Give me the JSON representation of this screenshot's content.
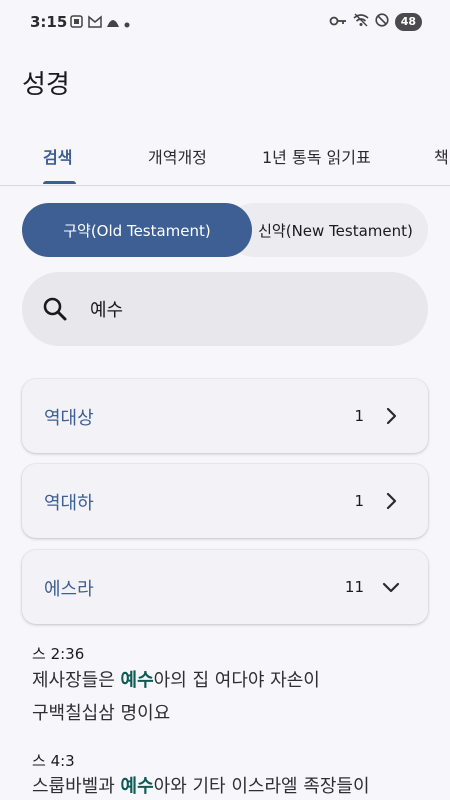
{
  "status_bar": {
    "time": "3:15",
    "battery": "48",
    "left_icons": [
      "screenshot-icon",
      "gmail-icon",
      "app-icon",
      "dot-icon"
    ],
    "right_icons": [
      "key-icon",
      "wifi-off-icon",
      "do-not-disturb-icon"
    ]
  },
  "app": {
    "title": "성경"
  },
  "tabs": [
    {
      "label": "검색"
    },
    {
      "label": "개역개정"
    },
    {
      "label": "1년 통독 읽기표"
    },
    {
      "label": "책"
    }
  ],
  "testament": {
    "old": "구약(Old Testament)",
    "new": "신약(New Testament)"
  },
  "search": {
    "value": "예수",
    "icon": "search-icon"
  },
  "books": [
    {
      "name": "역대상",
      "count": "1",
      "chevron": "chevron-right-icon"
    },
    {
      "name": "역대하",
      "count": "1",
      "chevron": "chevron-right-icon"
    },
    {
      "name": "에스라",
      "count": "11",
      "chevron": "chevron-down-icon"
    }
  ],
  "verses": [
    {
      "ref": "스 2:36",
      "line1_pre": "제사장들은 ",
      "line1_hl": "예수",
      "line1_post": "아의 집 여다야 자손이",
      "line2": "구백칠십삼 명이요"
    },
    {
      "ref": "스 4:3",
      "line1_pre": "스룹바벨과 ",
      "line1_hl": "예수",
      "line1_post": "아와 기타 이스라엘 족장들이"
    }
  ],
  "colors": {
    "accent": "#3D5F93",
    "highlight": "#0F5A55",
    "background": "#F7F6FA"
  }
}
